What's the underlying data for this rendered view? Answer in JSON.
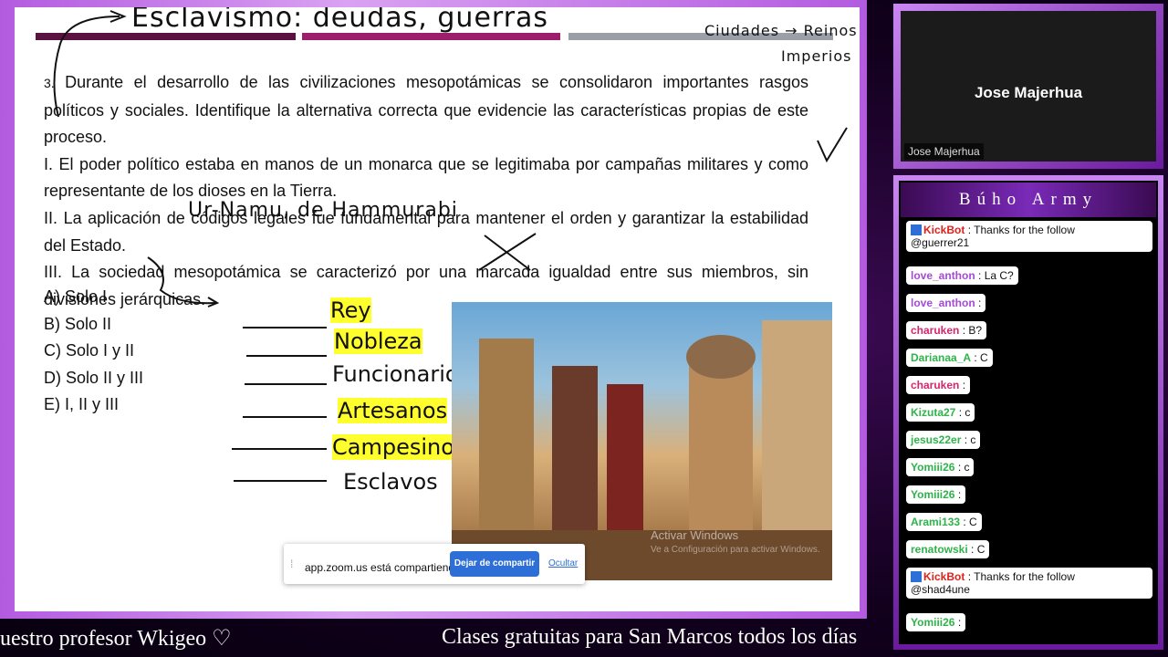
{
  "slide": {
    "handwriting_title": "Esclavismo: deudas, guerras",
    "handwriting_right": [
      "Ciudades → Reinos",
      "Imperios"
    ],
    "question": {
      "number": "3.",
      "intro": "Durante el desarrollo de las civilizaciones mesopotámicas se consolidaron importantes rasgos políticos y sociales. Identifique la alternativa correcta que evidencie las características propias de este proceso.",
      "statement_1": "I. El poder político estaba en manos de un monarca que se legitimaba por campañas militares y como representante de los dioses en la Tierra.",
      "statement_2": "II. La aplicación de códigos legales fue fundamental para mantener el orden y garantizar la estabilidad del Estado.",
      "statement_3": "III. La sociedad mesopotámica se caracterizó por una marcada igualdad entre sus miembros, sin divisiones jerárquicas."
    },
    "handwriting_codes": "Ur-Namu, de Hammurabi",
    "options": [
      "A) Solo I",
      "B) Solo II",
      "C) Solo I y II",
      "D) Solo II y III",
      "E) I, II y III"
    ],
    "hierarchy": [
      "Rey",
      "Nobleza",
      "Funcionarios",
      "Artesanos",
      "Campesinos",
      "Esclavos"
    ],
    "photo_watermark": {
      "line1": "Activar Windows",
      "line2": "Ve a Configuración para activar Windows."
    },
    "share_bar": {
      "message": "app.zoom.us está compartiendo tu pantalla.",
      "button": "Dejar de compartir",
      "hide": "Ocultar"
    }
  },
  "ticker": {
    "left": "uestro profesor Wkigeo ♡",
    "right": "Clases gratuitas para San Marcos todos los días"
  },
  "camera": {
    "name": "Jose Majerhua",
    "label": "Jose Majerhua"
  },
  "chat": {
    "title": "Búho Army",
    "messages": [
      {
        "user": "KickBot",
        "text": ": Thanks for the follow",
        "line2": "@guerrer21",
        "user_color": "#e0211b"
      },
      {
        "user": "love_anthon",
        "text": ": La C?",
        "user_color": "#a64ad6"
      },
      {
        "user": "love_anthon",
        "text": ":",
        "user_color": "#a64ad6"
      },
      {
        "user": "charuken",
        "text": ": B?",
        "user_color": "#d6266c"
      },
      {
        "user": "Darianaa_A",
        "text": ": C",
        "user_color": "#2fb34a"
      },
      {
        "user": "charuken",
        "text": ":",
        "user_color": "#d6266c"
      },
      {
        "user": "Kizuta27",
        "text": ": c",
        "user_color": "#2fb34a"
      },
      {
        "user": "jesus22er",
        "text": ": c",
        "user_color": "#2fb34a"
      },
      {
        "user": "Yomiii26",
        "text": ": c",
        "user_color": "#2fb34a"
      },
      {
        "user": "Yomiii26",
        "text": ":",
        "user_color": "#2fb34a"
      },
      {
        "user": "Arami133",
        "text": ": C",
        "user_color": "#2fb34a"
      },
      {
        "user": "renatowski",
        "text": ": C",
        "user_color": "#2fb34a"
      },
      {
        "user": "KickBot",
        "text": ": Thanks for the follow",
        "line2": "@shad4une",
        "user_color": "#e0211b"
      },
      {
        "user": "Yomiii26",
        "text": ":",
        "user_color": "#2fb34a"
      }
    ]
  }
}
